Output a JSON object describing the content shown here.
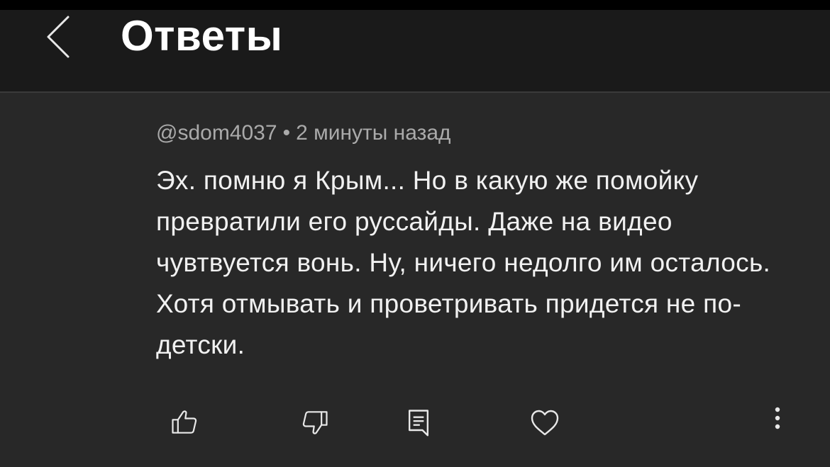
{
  "header": {
    "title": "Ответы",
    "back_icon": "chevron-left-icon"
  },
  "comment": {
    "author": "@sdom4037",
    "separator": "•",
    "time": "2 минуты назад",
    "text": "Эх. помню я Крым... Но в какую же помойку превратили его руссайды. Даже на видео чувтвуется вонь. Ну, ничего недолго им осталось. Хотя отмывать и проветривать придется не по-детски."
  },
  "actions": {
    "icons": [
      "thumb-up-icon",
      "thumb-down-icon",
      "reply-icon",
      "heart-icon",
      "more-vertical-icon"
    ]
  },
  "colors": {
    "background": "#282828",
    "header_bg": "#1a1a1a",
    "text": "#f1f1f1",
    "meta_text": "#aaaaaa"
  }
}
